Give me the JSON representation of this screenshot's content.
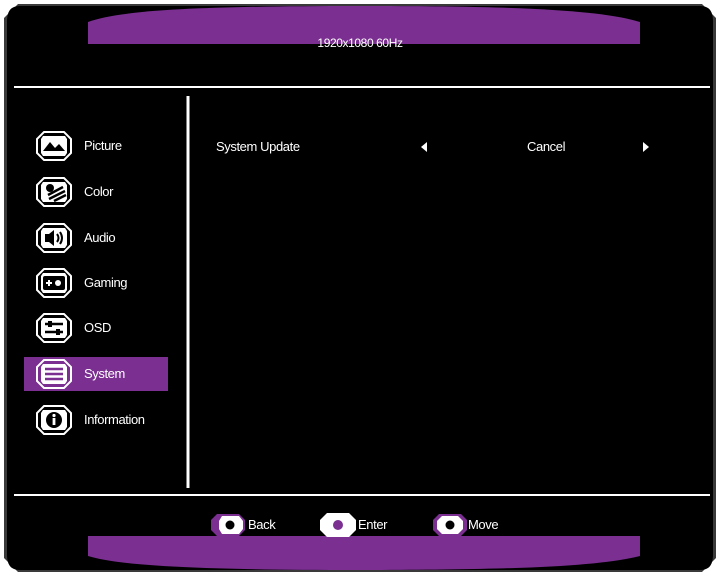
{
  "header": {
    "resolution": "1920x1080 60Hz"
  },
  "sidebar": {
    "items": [
      {
        "label": "Picture",
        "icon": "picture-icon",
        "selected": false
      },
      {
        "label": "Color",
        "icon": "color-icon",
        "selected": false
      },
      {
        "label": "Audio",
        "icon": "audio-icon",
        "selected": false
      },
      {
        "label": "Gaming",
        "icon": "gaming-icon",
        "selected": false
      },
      {
        "label": "OSD",
        "icon": "osd-icon",
        "selected": false
      },
      {
        "label": "System",
        "icon": "system-icon",
        "selected": true
      },
      {
        "label": "Information",
        "icon": "information-icon",
        "selected": false
      }
    ]
  },
  "main": {
    "setting": {
      "label": "System Update",
      "value": "Cancel",
      "prev_icon": "arrow-left-icon",
      "next_icon": "arrow-right-icon"
    }
  },
  "footer": {
    "hints": [
      {
        "label": "Back",
        "icon": "back-button-icon"
      },
      {
        "label": "Enter",
        "icon": "enter-button-icon"
      },
      {
        "label": "Move",
        "icon": "move-button-icon"
      }
    ]
  },
  "colors": {
    "accent": "#7a2f91",
    "panel": "#000000",
    "line": "#ffffff",
    "frame": "#3a3a3a"
  }
}
